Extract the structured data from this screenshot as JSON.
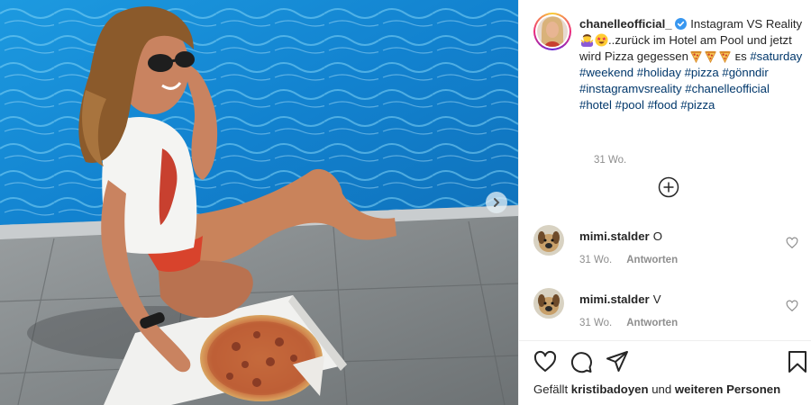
{
  "post": {
    "username": "chanelleofficial_",
    "caption_parts": [
      {
        "t": "text",
        "v": " Instagram VS Reality"
      },
      {
        "t": "emoji",
        "icon": "woman-shrugging-emoji"
      },
      {
        "t": "emoji",
        "icon": "star-struck-emoji"
      },
      {
        "t": "text",
        "v": "..zurück im Hotel am Pool und jetzt wird Pizza gegessen"
      },
      {
        "t": "emoji",
        "icon": "pizza-emoji"
      },
      {
        "t": "emoji",
        "icon": "pizza-emoji"
      },
      {
        "t": "emoji",
        "icon": "pizza-emoji"
      },
      {
        "t": "text",
        "v": " ᴇs "
      },
      {
        "t": "tag",
        "v": "#saturday"
      },
      {
        "t": "text",
        "v": " "
      },
      {
        "t": "tag",
        "v": "#weekend"
      },
      {
        "t": "text",
        "v": " "
      },
      {
        "t": "tag",
        "v": "#holiday"
      },
      {
        "t": "text",
        "v": " "
      },
      {
        "t": "tag",
        "v": "#pizza"
      },
      {
        "t": "text",
        "v": " "
      },
      {
        "t": "tag",
        "v": "#gönndir"
      },
      {
        "t": "text",
        "v": " "
      },
      {
        "t": "tag",
        "v": "#instagramvsreality"
      },
      {
        "t": "text",
        "v": " "
      },
      {
        "t": "tag",
        "v": "#chanelleofficial"
      },
      {
        "t": "text",
        "v": " "
      },
      {
        "t": "tag",
        "v": "#hotel"
      },
      {
        "t": "text",
        "v": " "
      },
      {
        "t": "tag",
        "v": "#pool"
      },
      {
        "t": "text",
        "v": " "
      },
      {
        "t": "tag",
        "v": "#food"
      },
      {
        "t": "text",
        "v": " "
      },
      {
        "t": "tag",
        "v": "#pizza"
      }
    ],
    "time_ago": "31 Wo."
  },
  "comments": [
    {
      "user": "mimi.stalder",
      "text": "O",
      "time": "31 Wo.",
      "reply": "Antworten"
    },
    {
      "user": "mimi.stalder",
      "text": "V",
      "time": "31 Wo.",
      "reply": "Antworten"
    }
  ],
  "likes": {
    "prefix": "Gefällt",
    "user": "kristibadoyen",
    "mid": "und",
    "rest": "weiteren Personen"
  },
  "icons": {
    "verified": "verified-badge-icon",
    "load_more": "plus-circle-icon",
    "like": "heart-icon",
    "comment": "comment-icon",
    "share": "send-icon",
    "save": "bookmark-icon",
    "next": "chevron-right-icon"
  },
  "colors": {
    "hashtag": "#00376b",
    "verified": "#3897f0",
    "muted": "#8e8e8e",
    "text": "#262626",
    "pool": "#1a8fd6"
  }
}
